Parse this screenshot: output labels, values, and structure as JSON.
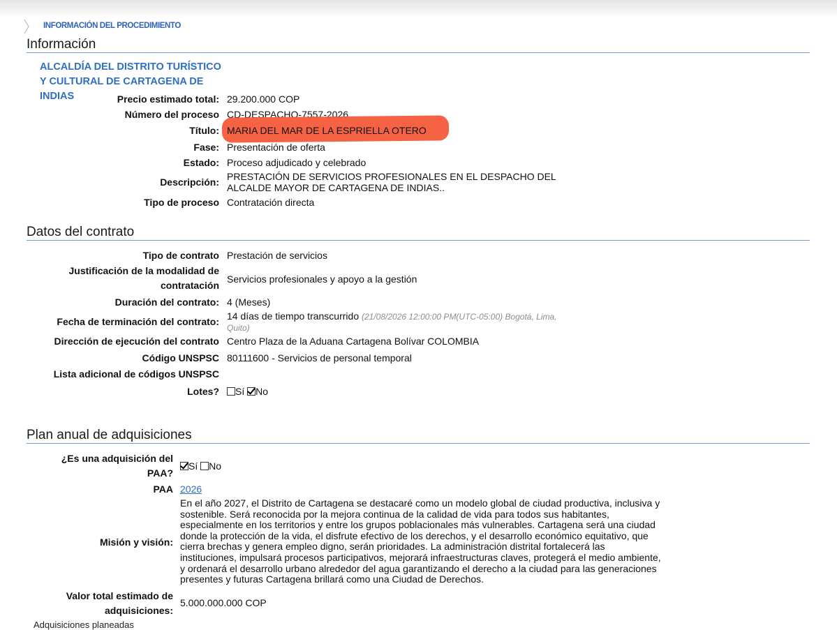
{
  "breadcrumb": "INFORMACIÓN DEL PROCEDIMIENTO",
  "sections": {
    "informacion": "Información",
    "datos_contrato": "Datos del contrato",
    "plan_anual": "Plan anual de adquisiciones"
  },
  "entity": "ALCALDÍA DEL DISTRITO TURÍSTICO Y CULTURAL DE CARTAGENA DE INDIAS",
  "info": {
    "precio_label": "Precio estimado total:",
    "precio_value": "29.200.000 COP",
    "numero_label": "Número del proceso",
    "numero_value": "CD-DESPACHO-7557-2026",
    "titulo_label": "Título:",
    "titulo_value": "MARIA DEL MAR DE LA ESPRIELLA OTERO",
    "fase_label": "Fase:",
    "fase_value": "Presentación de oferta",
    "estado_label": "Estado:",
    "estado_value": "Proceso adjudicado y celebrado",
    "descripcion_label": "Descripción:",
    "descripcion_line1": "PRESTACIÓN DE SERVICIOS PROFESIONALES EN EL DESPACHO DEL",
    "descripcion_line2": "ALCALDE MAYOR DE CARTAGENA DE INDIAS..",
    "tipo_proceso_label": "Tipo de proceso",
    "tipo_proceso_value": "Contratación directa"
  },
  "contrato": {
    "tipo_label": "Tipo de contrato",
    "tipo_value": "Prestación de servicios",
    "justificacion_label_1": "Justificación de la modalidad de",
    "justificacion_label_2": "contratación",
    "justificacion_value": "Servicios profesionales y apoyo a la gestión",
    "duracion_label": "Duración del contrato:",
    "duracion_value": "4 (Meses)",
    "fecha_label": "Fecha de terminación del contrato:",
    "fecha_value": "14 días de tiempo transcurrido",
    "fecha_note_1": "(21/08/2026 12:00:00 PM(UTC-05:00) Bogotá, Lima,",
    "fecha_note_2": "Quito)",
    "direccion_label": "Dirección de ejecución del contrato",
    "direccion_value": "Centro Plaza de la Aduana Cartagena Bolívar COLOMBIA",
    "unspsc_label": "Código UNSPSC",
    "unspsc_value": "80111600 - Servicios de personal temporal",
    "lista_label": "Lista adicional de códigos UNSPSC",
    "lotes_label": "Lotes?",
    "lotes_si": "Sí",
    "lotes_no": "No",
    "lotes_selected": "No"
  },
  "plan": {
    "paa_q_label_1": "¿Es una adquisición del",
    "paa_q_label_2": "PAA?",
    "paa_si": "Sí",
    "paa_no": "No",
    "paa_selected": "Sí",
    "paa_label": "PAA",
    "paa_link": "2026",
    "mision_label": "Misión y visión:",
    "mision_text": "En el año 2027, el Distrito de Cartagena se destacaré como un modelo global de ciudad productiva, inclusiva y sostenible. Será reconocida por la mejora continua de la calidad de vida para todos sus habitantes, especialmente en los territorios y entre los grupos poblacionales más vulnerables. Cartagena será una ciudad donde la protección de la vida, el disfrute efectivo de los derechos, y el desarrollo económico equitativo, que cierra brechas y genera empleo digno, serán prioridades. La administración distrital fortalecerá las instituciones, impulsará procesos participativos, mejorará infraestructuras claves, protegerá el medio ambiente, y ordenará el desarrollo urbano alrededor del agua garantizando el derecho a la ciudad para las generaciones presentes y futuras Cartagena brillará como una Ciudad de Derechos.",
    "valor_label_1": "Valor total estimado de",
    "valor_label_2": "adquisiciones:",
    "valor_value": "5.000.000.000 COP",
    "adquisiciones_label": "Adquisiciones planeadas"
  },
  "colors": {
    "link": "#2e6fc2",
    "rule": "#6f9fd2",
    "highlight": "#f45a3a"
  }
}
